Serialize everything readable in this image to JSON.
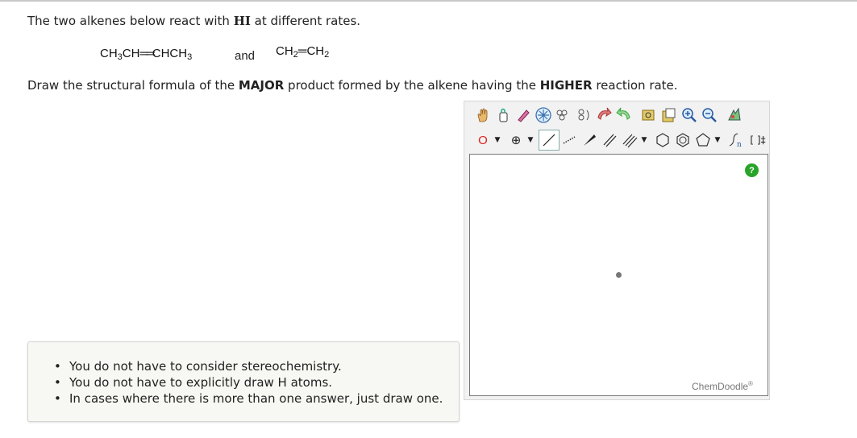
{
  "question": {
    "intro_before": "The two alkenes below react with ",
    "reagent": "HI",
    "intro_after": " at different rates.",
    "alkene1": {
      "p1": "CH",
      "s1": "3",
      "p2": "CH",
      "bond": "══",
      "p3": "CHCH",
      "s2": "3"
    },
    "connector": "and",
    "alkene2": {
      "p1": "CH",
      "s1": "2",
      "bond": "═",
      "p2": "CH",
      "s2": "2"
    },
    "prompt_a": "Draw the structural formula of the ",
    "prompt_b": "MAJOR",
    "prompt_c": " product formed by the alkene having the ",
    "prompt_d": "HIGHER",
    "prompt_e": " reaction rate."
  },
  "editor": {
    "help_label": "?",
    "brand": "ChemDoodle",
    "brand_mark": "®",
    "element_label": "O",
    "charge_label": "⊕",
    "template_label": "[ ]‡",
    "toolbar_row1_icons": [
      "hand-icon",
      "lasso-icon",
      "eraser-icon",
      "center-icon",
      "flip-icon",
      "undo-icon",
      "redo-icon",
      "clean-icon",
      "copy-icon",
      "zoom-in-icon",
      "zoom-out-icon",
      "settings-icon"
    ],
    "toolbar_row2_icons": [
      "element-icon",
      "charge-icon",
      "single-bond-icon",
      "dashed-bond-icon",
      "wedge-bond-icon",
      "double-bond-icon",
      "triple-bond-icon",
      "cyclohexane-icon",
      "benzene-icon",
      "pentagon-icon",
      "polymer-icon",
      "bracket-icon"
    ]
  },
  "notes": {
    "items": [
      "You do not have to consider stereochemistry.",
      "You do not have to explicitly draw H atoms.",
      "In cases where there is more than one answer, just draw one."
    ]
  },
  "colors": {
    "help": "#28a428",
    "panel": "#f2f2f2",
    "notes_bg": "#f7f7f3"
  }
}
